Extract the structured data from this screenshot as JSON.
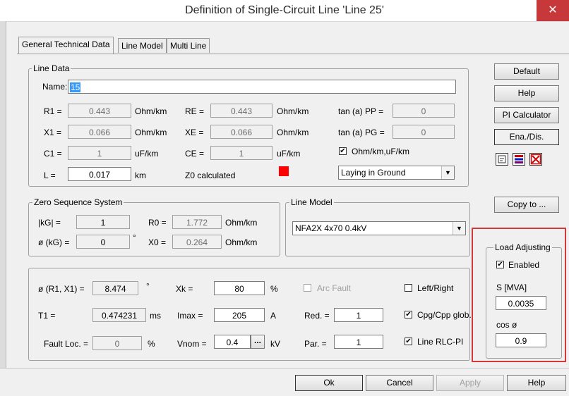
{
  "window": {
    "title": "Definition of Single-Circuit Line 'Line 25'",
    "close_glyph": "✕"
  },
  "tabs": [
    "General Technical Data",
    "Line Model",
    "Multi Line"
  ],
  "line_data": {
    "group_title": "Line Data",
    "name_label": "Name:",
    "name_value": "15",
    "r1_label": "R1 =",
    "r1_value": "0.443",
    "r1_unit": "Ohm/km",
    "x1_label": "X1 =",
    "x1_value": "0.066",
    "x1_unit": "Ohm/km",
    "c1_label": "C1 =",
    "c1_value": "1",
    "c1_unit": "uF/km",
    "l_label": "L =",
    "l_value": "0.017",
    "l_unit": "km",
    "re_label": "RE =",
    "re_value": "0.443",
    "re_unit": "Ohm/km",
    "xe_label": "XE =",
    "xe_value": "0.066",
    "xe_unit": "Ohm/km",
    "ce_label": "CE =",
    "ce_value": "1",
    "ce_unit": "uF/km",
    "z0_label": "Z0 calculated",
    "tanpp_label": "tan (a) PP =",
    "tanpp_value": "0",
    "tanpg_label": "tan (a) PG =",
    "tanpg_value": "0",
    "ohm_check_label": "Ohm/km,uF/km",
    "ohm_checked": true,
    "laying_value": "Laying in Ground",
    "z0_indicator_color": "#ff0000"
  },
  "zero_seq": {
    "group_title": "Zero Sequence System",
    "kg_label": "|kG| =",
    "kg_value": "1",
    "phikg_label": "ø (kG) =",
    "phikg_value": "0",
    "phikg_unit": "°",
    "r0_label": "R0 =",
    "r0_value": "1.772",
    "r0_unit": "Ohm/km",
    "x0_label": "X0 =",
    "x0_value": "0.264",
    "x0_unit": "Ohm/km"
  },
  "line_model": {
    "group_title": "Line Model",
    "value": "NFA2X 4x70 0.4kV"
  },
  "params": {
    "phi_label": "ø (R1, X1) =",
    "phi_value": "8.474",
    "phi_unit": "°",
    "t1_label": "T1 =",
    "t1_value": "0.474231",
    "t1_unit": "ms",
    "fault_label": "Fault Loc. =",
    "fault_value": "0",
    "fault_unit": "%",
    "xk_label": "Xk =",
    "xk_value": "80",
    "xk_unit": "%",
    "imax_label": "Imax =",
    "imax_value": "205",
    "imax_unit": "A",
    "vnom_label": "Vnom =",
    "vnom_value": "0.4",
    "vnom_btn": "...",
    "vnom_unit": "kV",
    "arc_label": "Arc Fault",
    "arc_checked": false,
    "red_label": "Red. =",
    "red_value": "1",
    "par_label": "Par. =",
    "par_value": "1",
    "leftright_label": "Left/Right",
    "leftright_checked": false,
    "cpg_label": "Cpg/Cpp glob.",
    "cpg_checked": true,
    "rlc_label": "Line RLC-PI",
    "rlc_checked": true
  },
  "side_buttons": {
    "default": "Default",
    "help": "Help",
    "pi_calc": "PI Calculator",
    "ena_dis": "Ena./Dis.",
    "copy_to": "Copy to ..."
  },
  "load_adjusting": {
    "group_title": "Load Adjusting",
    "enabled_label": "Enabled",
    "enabled_checked": true,
    "s_label": "S [MVA]",
    "s_value": "0.0035",
    "cos_label": "cos ø",
    "cos_value": "0.9",
    "highlight_color": "#d23a3a"
  },
  "footer": {
    "ok": "Ok",
    "cancel": "Cancel",
    "apply": "Apply",
    "help": "Help"
  },
  "icons": {
    "check": "✔",
    "dropdown": "▼"
  }
}
